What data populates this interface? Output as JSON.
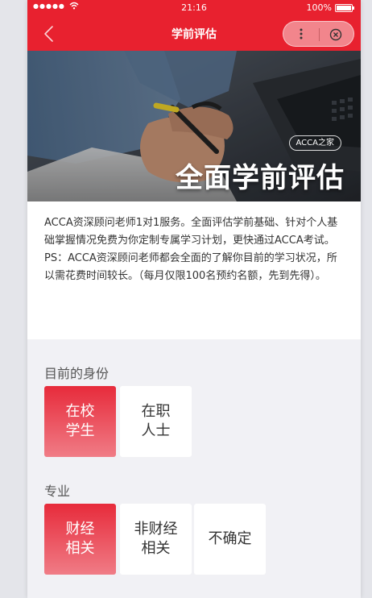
{
  "status_bar": {
    "signal": "●●●●●",
    "time": "21:16",
    "battery": "100%"
  },
  "nav": {
    "title": "学前评估"
  },
  "banner": {
    "badge": "ACCA之家",
    "headline": "全面学前评估"
  },
  "description": {
    "para1": "ACCA资深顾问老师1对1服务。全面评估学前基础、针对个人基础掌握情况免费为你定制专属学习计划，更快通过ACCA考试。",
    "para2": "PS：ACCA资深顾问老师都会全面的了解你目前的学习状况，所以需花费时间较长。（每月仅限100名预约名额，先到先得）。"
  },
  "identity": {
    "label": "目前的身份",
    "options": [
      {
        "label": "在校\n学生",
        "selected": true
      },
      {
        "label": "在职\n人士",
        "selected": false
      }
    ]
  },
  "major": {
    "label": "专业",
    "options": [
      {
        "label": "财经\n相关",
        "selected": true
      },
      {
        "label": "非财经\n相关",
        "selected": false
      },
      {
        "label": "不确定",
        "selected": false
      }
    ]
  },
  "colors": {
    "accent": "#e8212f",
    "background": "#f1f1f5"
  },
  "icons": [
    "back-arrow-icon",
    "more-dots-icon",
    "close-circle-icon",
    "wifi-icon",
    "battery-icon"
  ]
}
